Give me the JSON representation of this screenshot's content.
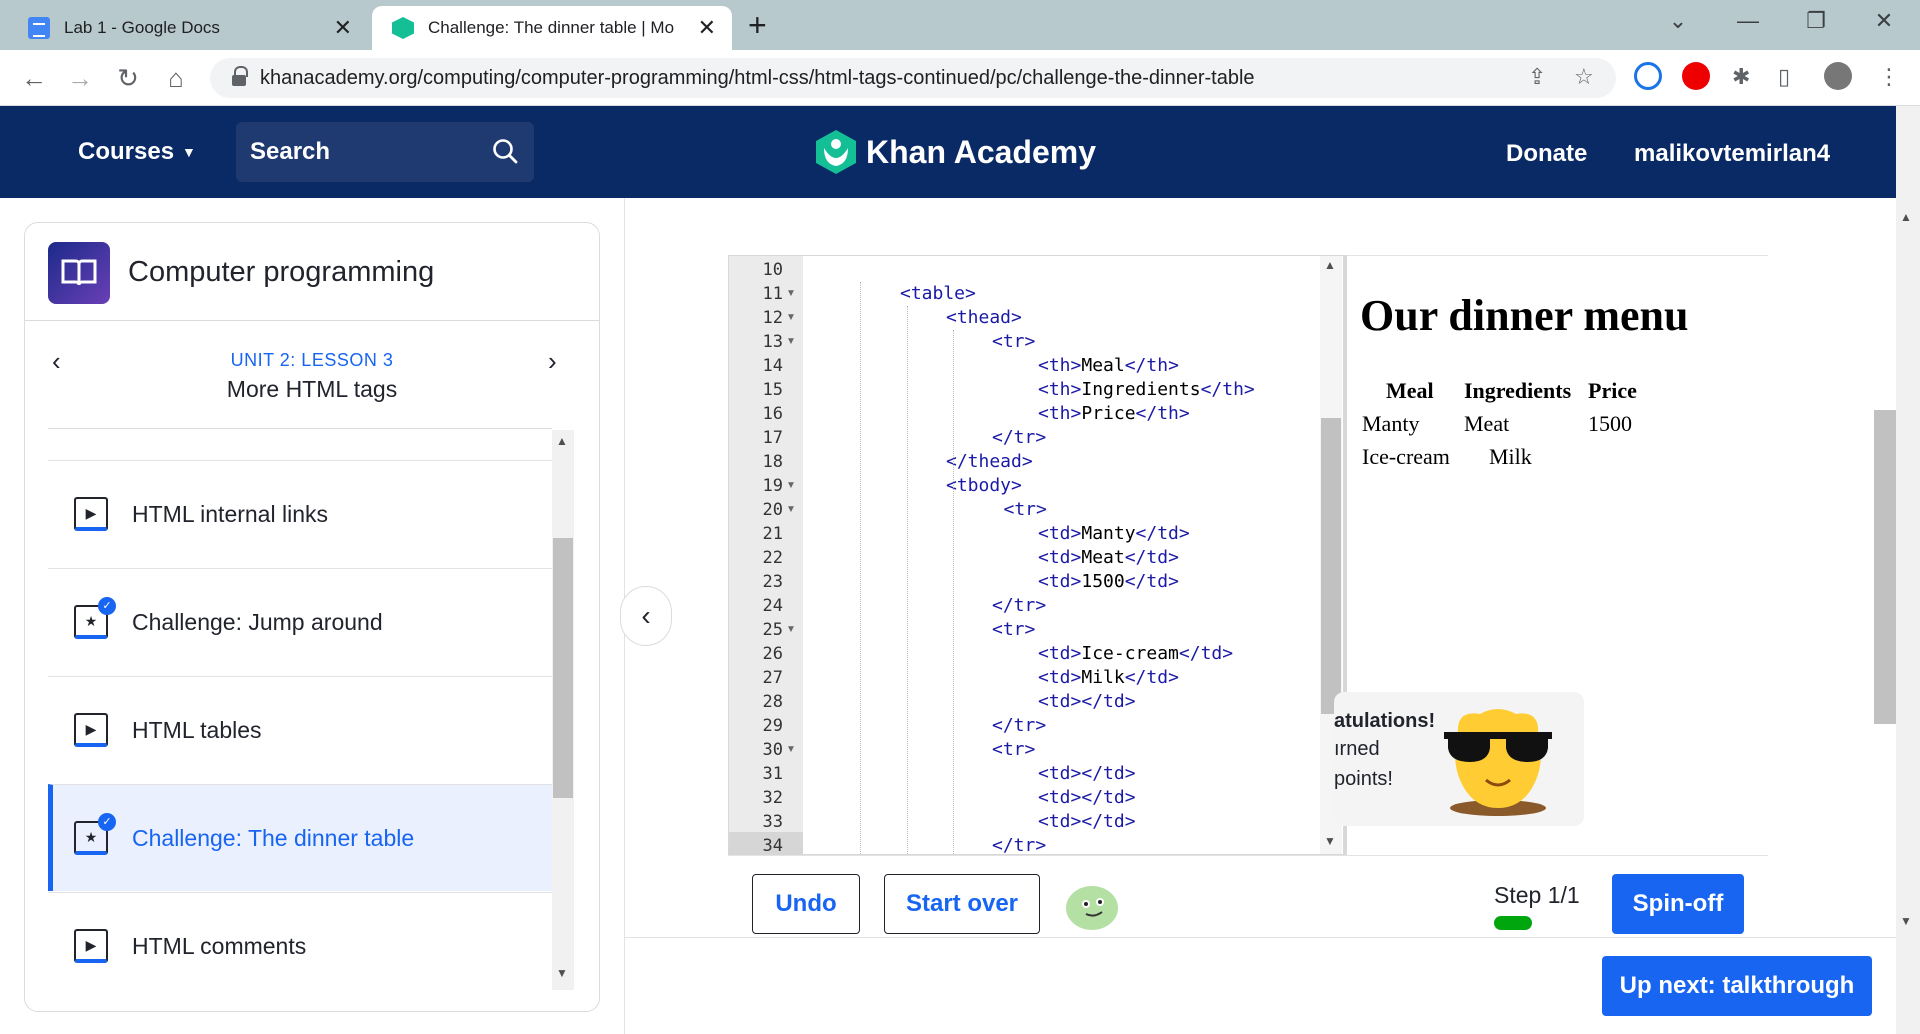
{
  "browser": {
    "tabs": [
      {
        "title": "Lab 1 - Google Docs",
        "close": "✕"
      },
      {
        "title": "Challenge: The dinner table | Mo",
        "close": "✕"
      }
    ],
    "new_tab": "+",
    "url": "khanacademy.org/computing/computer-programming/html-css/html-tags-continued/pc/challenge-the-dinner-table"
  },
  "header": {
    "courses_label": "Courses",
    "search_label": "Search",
    "logo_text": "Khan Academy",
    "donate_label": "Donate",
    "username": "malikovtemirlan4",
    "colors": {
      "bg": "#0a2a66",
      "accent": "#14bf96"
    }
  },
  "sidebar": {
    "course_title": "Computer programming",
    "unit_label": "UNIT 2: LESSON 3",
    "lesson_title": "More HTML tags",
    "items": [
      {
        "label": "HTML internal links",
        "type": "video",
        "done": false,
        "active": false
      },
      {
        "label": "Challenge: Jump around",
        "type": "challenge",
        "done": true,
        "active": false
      },
      {
        "label": "HTML tables",
        "type": "video",
        "done": false,
        "active": false
      },
      {
        "label": "Challenge: The dinner table",
        "type": "challenge",
        "done": true,
        "active": true
      },
      {
        "label": "HTML comments",
        "type": "video",
        "done": false,
        "active": false
      }
    ]
  },
  "editor": {
    "lines": [
      {
        "n": "10",
        "fold": false,
        "indent": 0,
        "text": ""
      },
      {
        "n": "11",
        "fold": true,
        "indent": 0,
        "text": "<table>"
      },
      {
        "n": "12",
        "fold": true,
        "indent": 1,
        "text": "<thead>"
      },
      {
        "n": "13",
        "fold": true,
        "indent": 2,
        "text": "<tr>"
      },
      {
        "n": "14",
        "fold": false,
        "indent": 3,
        "text": "<th>Meal</th>"
      },
      {
        "n": "15",
        "fold": false,
        "indent": 3,
        "text": "<th>Ingredients</th>"
      },
      {
        "n": "16",
        "fold": false,
        "indent": 3,
        "text": "<th>Price</th>"
      },
      {
        "n": "17",
        "fold": false,
        "indent": 2,
        "text": "</tr>"
      },
      {
        "n": "18",
        "fold": false,
        "indent": 1,
        "text": "</thead>"
      },
      {
        "n": "19",
        "fold": true,
        "indent": 1,
        "text": "<tbody>"
      },
      {
        "n": "20",
        "fold": true,
        "indent": 2.25,
        "text": "<tr>"
      },
      {
        "n": "21",
        "fold": false,
        "indent": 3,
        "text": "<td>Manty</td>"
      },
      {
        "n": "22",
        "fold": false,
        "indent": 3,
        "text": "<td>Meat</td>"
      },
      {
        "n": "23",
        "fold": false,
        "indent": 3,
        "text": "<td>1500</td>"
      },
      {
        "n": "24",
        "fold": false,
        "indent": 2,
        "text": "</tr>"
      },
      {
        "n": "25",
        "fold": true,
        "indent": 2,
        "text": "<tr>"
      },
      {
        "n": "26",
        "fold": false,
        "indent": 3,
        "text": "<td>Ice-cream</td>"
      },
      {
        "n": "27",
        "fold": false,
        "indent": 3,
        "text": "<td>Milk</td>"
      },
      {
        "n": "28",
        "fold": false,
        "indent": 3,
        "text": "<td></td>"
      },
      {
        "n": "29",
        "fold": false,
        "indent": 2,
        "text": "</tr>"
      },
      {
        "n": "30",
        "fold": true,
        "indent": 2,
        "text": "<tr>"
      },
      {
        "n": "31",
        "fold": false,
        "indent": 3,
        "text": "<td></td>"
      },
      {
        "n": "32",
        "fold": false,
        "indent": 3,
        "text": "<td></td>"
      },
      {
        "n": "33",
        "fold": false,
        "indent": 3,
        "text": "<td></td>"
      },
      {
        "n": "34",
        "fold": false,
        "indent": 2,
        "text": "</tr>"
      }
    ]
  },
  "output": {
    "title": "Our dinner menu",
    "headers": [
      "Meal",
      "Ingredients",
      "Price"
    ],
    "rows": [
      [
        "Manty",
        "Meat",
        "1500"
      ],
      [
        "Ice-cream",
        "Milk",
        ""
      ]
    ]
  },
  "toast": {
    "line1": "atulations!",
    "line2": "ırned",
    "line3": "points!"
  },
  "controls": {
    "undo_label": "Undo",
    "startover_label": "Start over",
    "step_label": "Step 1/1",
    "spinoff_label": "Spin-off",
    "upnext_label": "Up next: talkthrough",
    "step_progress": 1.0
  }
}
